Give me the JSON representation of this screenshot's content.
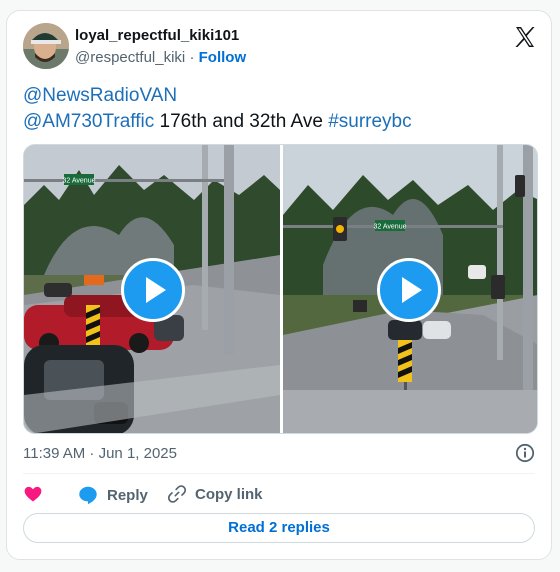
{
  "author": {
    "display_name": "loyal_repectful_kiki101",
    "handle": "@respectful_kiki",
    "separator": " · ",
    "follow_label": "Follow",
    "avatar_icon": "user-avatar"
  },
  "tweet": {
    "mention1": "@NewsRadioVAN",
    "mention2": "@AM730Traffic",
    "text": " 176th and 32th Ave ",
    "hashtag": "#surreybc"
  },
  "media": {
    "left_sign": "32 Avenue",
    "right_sign": "32 Avenue"
  },
  "meta": {
    "timestamp": "11:39 AM · Jun 1, 2025"
  },
  "actions": {
    "reply_label": "Reply",
    "copy_link_label": "Copy link",
    "read_replies_label": "Read 2 replies"
  },
  "colors": {
    "link": "#1d6fb8",
    "accent": "#1d9bf0",
    "like": "#f91880"
  }
}
